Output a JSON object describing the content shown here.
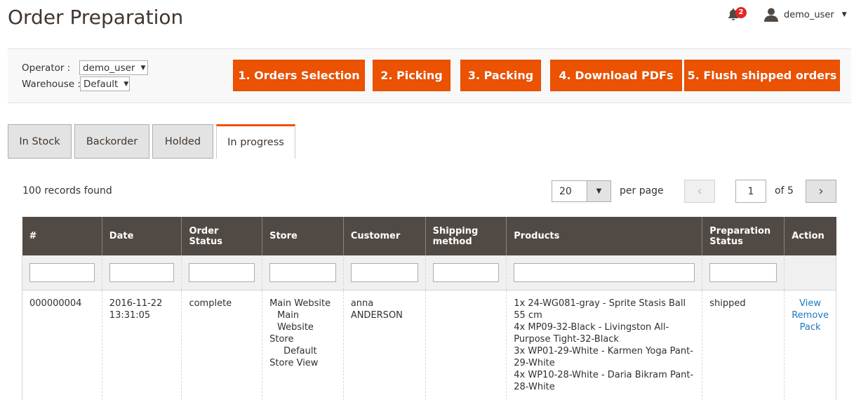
{
  "page": {
    "title": "Order Preparation"
  },
  "header": {
    "notifications_count": "2",
    "username": "demo_user"
  },
  "toolbar": {
    "operator_label": "Operator :",
    "operator_value": "demo_user",
    "warehouse_label": "Warehouse :",
    "warehouse_value": "Default",
    "buttons": [
      "1. Orders Selection",
      "2. Picking",
      "3. Packing",
      "4. Download PDFs",
      "5. Flush shipped orders"
    ],
    "accent_color": "#eb5202"
  },
  "tabs": [
    "In Stock",
    "Backorder",
    "Holded",
    "In progress"
  ],
  "active_tab": "In progress",
  "grid": {
    "records_found": "100 records found",
    "per_page_value": "20",
    "per_page_label": "per page",
    "current_page": "1",
    "total_pages_label": "of 5",
    "columns": [
      "#",
      "Date",
      "Order Status",
      "Store",
      "Customer",
      "Shipping method",
      "Products",
      "Preparation Status",
      "Action"
    ],
    "rows": [
      {
        "id": "000000004",
        "date_line1": "2016-11-22",
        "date_line2": "13:31:05",
        "status": "complete",
        "store_line1": "Main Website",
        "store_line2": "Main Website",
        "store_line3": "Store",
        "store_line4": "Default",
        "store_line5": "Store View",
        "customer_first": "anna",
        "customer_last": "ANDERSON",
        "shipping": "",
        "products": [
          "1x 24-WG081-gray - Sprite Stasis Ball 55 cm",
          "4x MP09-32-Black - Livingston All-Purpose Tight-32-Black",
          "3x WP01-29-White - Karmen Yoga Pant-29-White",
          "4x WP10-28-White - Daria Bikram Pant-28-White"
        ],
        "prep_status": "shipped",
        "actions": [
          "View",
          "Remove",
          "Pack"
        ]
      }
    ]
  }
}
